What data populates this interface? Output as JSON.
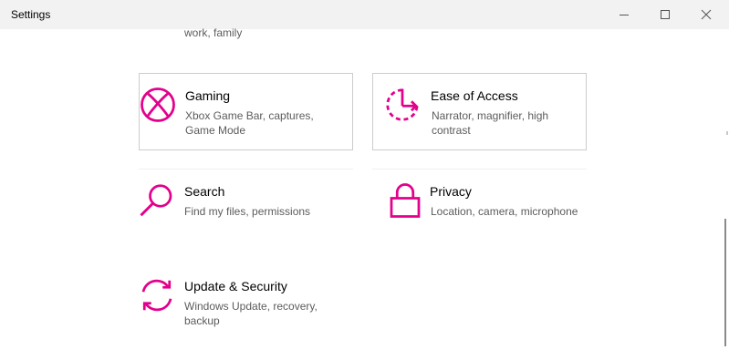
{
  "window": {
    "title": "Settings"
  },
  "accent_color": "#e3008c",
  "partial_above": {
    "description": "work, family"
  },
  "tiles": [
    {
      "label": "Gaming",
      "description": "Xbox Game Bar, captures, Game Mode",
      "icon": "xbox-icon"
    },
    {
      "label": "Ease of Access",
      "description": "Narrator, magnifier, high contrast",
      "icon": "ease-of-access-icon"
    },
    {
      "label": "Search",
      "description": "Find my files, permissions",
      "icon": "search-icon"
    },
    {
      "label": "Privacy",
      "description": "Location, camera, microphone",
      "icon": "lock-icon"
    },
    {
      "label": "Update & Security",
      "description": "Windows Update, recovery, backup",
      "icon": "sync-icon"
    }
  ]
}
